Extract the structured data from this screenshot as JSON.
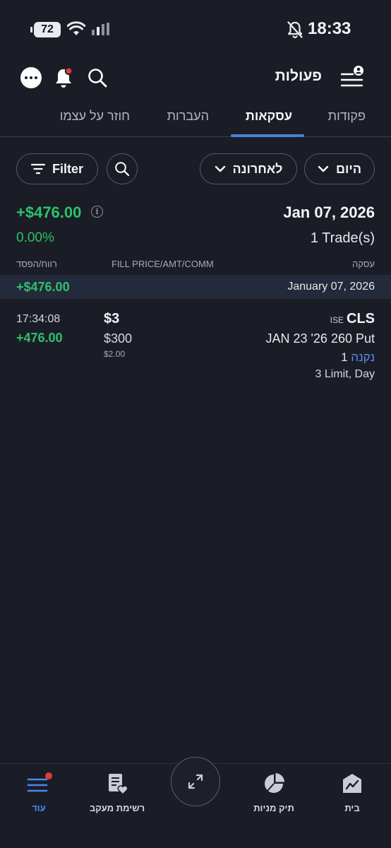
{
  "status_bar": {
    "battery": "72",
    "time": "18:33"
  },
  "header": {
    "title": "פעולות"
  },
  "tabs": [
    {
      "label": "פקודות",
      "active": false
    },
    {
      "label": "עסקאות",
      "active": true
    },
    {
      "label": "העברות",
      "active": false
    },
    {
      "label": "חוזר על עצמו",
      "active": false
    }
  ],
  "filters": {
    "period": "היום",
    "sort": "לאחרונה",
    "filter_label": "Filter"
  },
  "summary": {
    "pl": "+$476.00",
    "pct": "0.00%",
    "date": "Jan 07, 2026",
    "trade_count": "1 Trade(s)"
  },
  "columns": {
    "trade": "עסקה",
    "fill": "FILL PRICE/AMT/COMM",
    "pl": "רווח/הפסד"
  },
  "date_group": {
    "date": "January 07, 2026",
    "pl": "+$476.00"
  },
  "trade": {
    "symbol": "CLS",
    "exchange": "ISE",
    "contract": "JAN 23 '26 260 Put",
    "side": "נקנה",
    "qty": "1",
    "order": "3 Limit, Day",
    "price": "$3",
    "amount": "$300",
    "commission": "$2.00",
    "time": "17:34:08",
    "pl": "+476.00"
  },
  "bottom_nav": [
    {
      "label": "עוד",
      "icon": "menu-icon",
      "active": true
    },
    {
      "label": "רשימת מעקב",
      "icon": "watchlist-icon",
      "active": false
    },
    {
      "label": "תיק מניות",
      "icon": "pie-chart-icon",
      "active": false
    },
    {
      "label": "בית",
      "icon": "home-chart-icon",
      "active": false
    }
  ],
  "colors": {
    "background": "#1a1d26",
    "positive": "#2cc26a",
    "accent": "#4c7fdc",
    "notification": "#e53935"
  }
}
